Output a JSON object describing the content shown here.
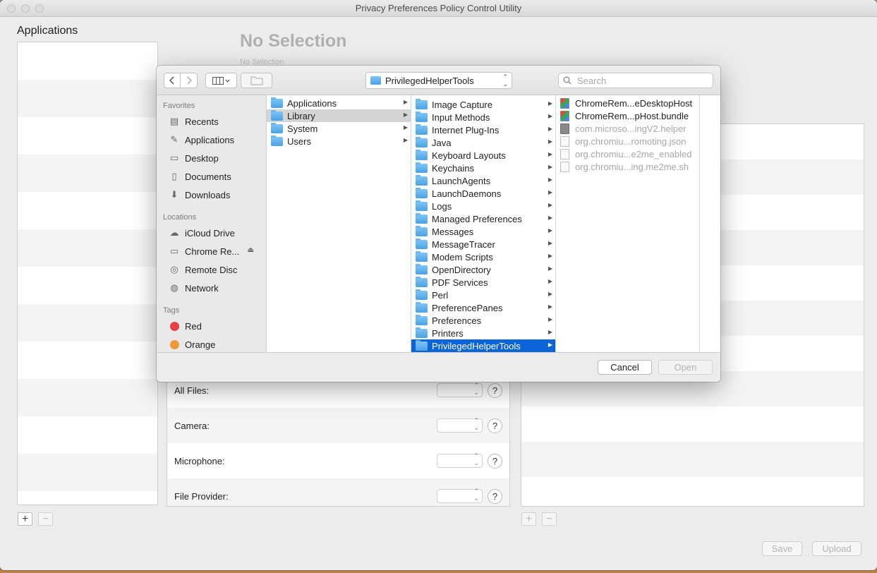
{
  "window": {
    "title": "Privacy Preferences Policy Control Utility"
  },
  "applications": {
    "title": "Applications"
  },
  "selection": {
    "title": "No Selection",
    "subtitle": "No Selection"
  },
  "permissions": [
    {
      "label": "All Files:"
    },
    {
      "label": "Camera:"
    },
    {
      "label": "Microphone:"
    },
    {
      "label": "File Provider:"
    }
  ],
  "permission_help": "?",
  "buttons": {
    "add": "+",
    "remove": "−",
    "save": "Save",
    "upload": "Upload"
  },
  "dialog": {
    "path": "PrivilegedHelperTools",
    "search_placeholder": "Search",
    "sidebar": {
      "favorites_header": "Favorites",
      "favorites": [
        "Recents",
        "Applications",
        "Desktop",
        "Documents",
        "Downloads"
      ],
      "locations_header": "Locations",
      "locations": [
        "iCloud Drive",
        "Chrome Re...",
        "Remote Disc",
        "Network"
      ],
      "tags_header": "Tags",
      "tags": [
        {
          "name": "Red",
          "color": "#e84040"
        },
        {
          "name": "Orange",
          "color": "#f0983a"
        }
      ]
    },
    "column1": [
      "Applications",
      "Library",
      "System",
      "Users"
    ],
    "column2": [
      "Image Capture",
      "Input Methods",
      "Internet Plug-Ins",
      "Java",
      "Keyboard Layouts",
      "Keychains",
      "LaunchAgents",
      "LaunchDaemons",
      "Logs",
      "Managed Preferences",
      "Messages",
      "MessageTracer",
      "Modem Scripts",
      "OpenDirectory",
      "PDF Services",
      "Perl",
      "PreferencePanes",
      "Preferences",
      "Printers",
      "PrivilegedHelperTools"
    ],
    "column3": [
      "ChromeRem...eDesktopHost",
      "ChromeRem...pHost.bundle",
      "com.microso...ingV2.helper",
      "org.chromiu...romoting.json",
      "org.chromiu...e2me_enabled",
      "org.chromiu...ing.me2me.sh"
    ],
    "cancel_label": "Cancel",
    "open_label": "Open"
  },
  "colors": {
    "selection_accent": "#0a64d8",
    "folder": "#5aaeed"
  }
}
